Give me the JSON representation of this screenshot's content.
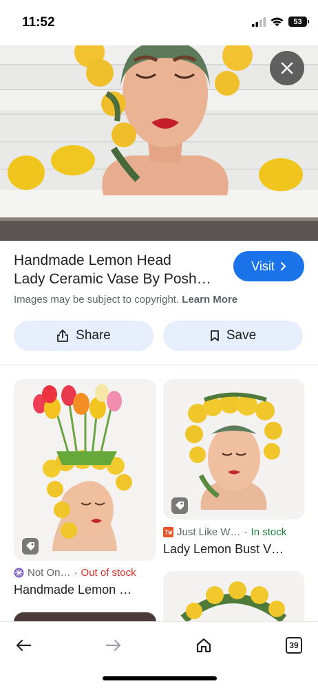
{
  "status_bar": {
    "time": "11:52",
    "battery": "53"
  },
  "result": {
    "title_line1": "Handmade Lemon Head",
    "title_line2": "Lady Ceramic Vase By Posh…",
    "visit_label": "Visit",
    "copyright_prefix": "Images may be subject to copyright.",
    "learn_more": "Learn More",
    "share_label": "Share",
    "save_label": "Save"
  },
  "related": [
    {
      "source": "Not On…",
      "stock": "Out of stock",
      "title": "Handmade Lemon …"
    },
    {
      "source": "Just Like W…",
      "stock": "In stock",
      "title": "Lady Lemon Bust V…"
    }
  ],
  "nav": {
    "tab_count": "39"
  },
  "colors": {
    "accent": "#1a73e8",
    "out_of_stock": "#d93025",
    "in_stock": "#188038"
  }
}
